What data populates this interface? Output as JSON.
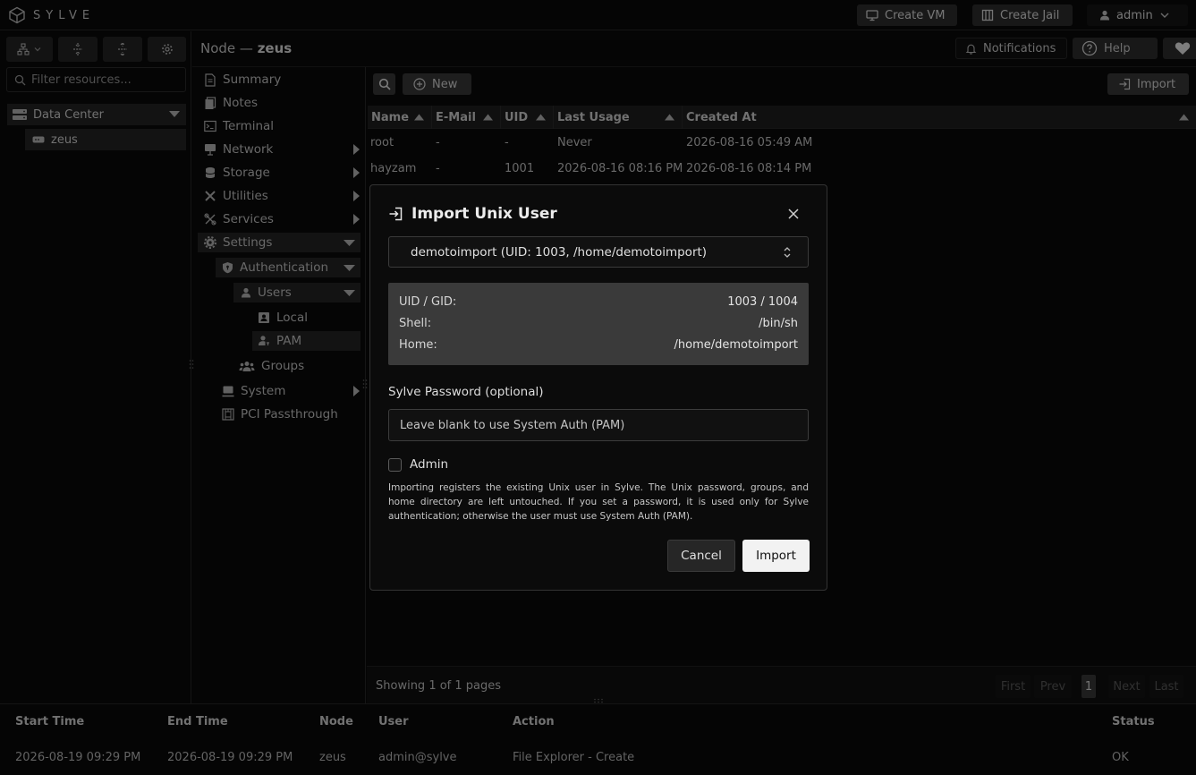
{
  "app": {
    "brand": "SYLVE"
  },
  "topbar": {
    "create_vm": "Create VM",
    "create_jail": "Create Jail",
    "user": "admin"
  },
  "sidebar": {
    "filter_placeholder": "Filter resources...",
    "tree": {
      "datacenter": "Data Center",
      "node": "zeus"
    }
  },
  "header": {
    "prefix": "Node — ",
    "node": "zeus",
    "notifications": "Notifications",
    "help": "Help"
  },
  "nav": {
    "summary": "Summary",
    "notes": "Notes",
    "terminal": "Terminal",
    "network": "Network",
    "storage": "Storage",
    "utilities": "Utilities",
    "services": "Services",
    "settings": "Settings",
    "authentication": "Authentication",
    "users": "Users",
    "local": "Local",
    "pam": "PAM",
    "groups": "Groups",
    "system": "System",
    "pci": "PCI Passthrough"
  },
  "toolbar": {
    "new": "New",
    "import": "Import"
  },
  "table": {
    "columns": [
      "Name",
      "E-Mail",
      "UID",
      "Last Usage",
      "Created At"
    ],
    "rows": [
      [
        "root",
        "-",
        "-",
        "Never",
        "2026-08-16 05:49 AM"
      ],
      [
        "hayzam",
        "-",
        "1001",
        "2026-08-16 08:16 PM",
        "2026-08-16 08:14 PM"
      ]
    ]
  },
  "pager": {
    "showing": "Showing 1 of 1 pages",
    "first": "First",
    "prev": "Prev",
    "page": "1",
    "next": "Next",
    "last": "Last"
  },
  "log": {
    "columns": [
      "Start Time",
      "End Time",
      "Node",
      "User",
      "Action",
      "Status"
    ],
    "row": [
      "2026-08-19 09:29 PM",
      "2026-08-19 09:29 PM",
      "zeus",
      "admin@sylve",
      "File Explorer - Create",
      "OK"
    ]
  },
  "modal": {
    "title": "Import Unix User",
    "selected_user": "demotoimport (UID: 1003, /home/demotoimport)",
    "info": [
      {
        "key": "UID / GID:",
        "value": "1003 / 1004"
      },
      {
        "key": "Shell:",
        "value": "/bin/sh"
      },
      {
        "key": "Home:",
        "value": "/home/demotoimport"
      }
    ],
    "password_label": "Sylve Password (optional)",
    "password_placeholder": "Leave blank to use System Auth (PAM)",
    "admin_label": "Admin",
    "admin_checked": false,
    "note": "Importing registers the existing Unix user in Sylve. The Unix password, groups, and home directory are left untouched. If you set a password, it is used only for Sylve authentication; otherwise the user must use System Auth (PAM).",
    "cancel": "Cancel",
    "import": "Import"
  }
}
